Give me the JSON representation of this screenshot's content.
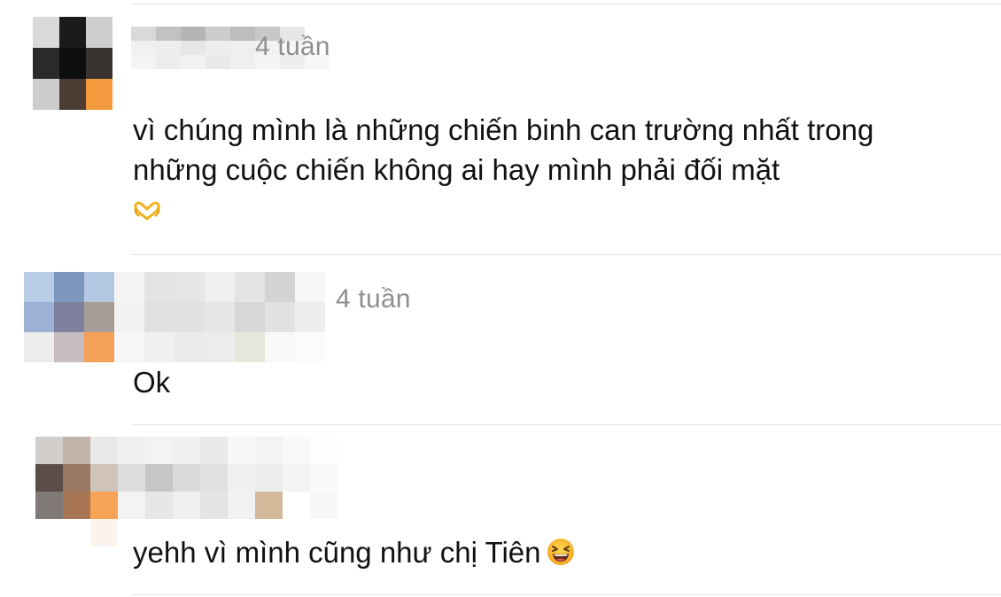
{
  "comments": [
    {
      "time": "4 tuần",
      "text_lines": [
        "vì chúng mình là những chiến binh can trường nhất trong",
        "những cuộc chiến không ai hay mình phải đối mặt"
      ],
      "emoji": "heart-hands-emoji"
    },
    {
      "time": "4 tuần",
      "text_lines": [
        "Ok"
      ]
    },
    {
      "time": "",
      "text_lines": [
        "yehh vì mình cũng như chị Tiên"
      ],
      "emoji": "grinning-squinting-face-emoji"
    }
  ]
}
